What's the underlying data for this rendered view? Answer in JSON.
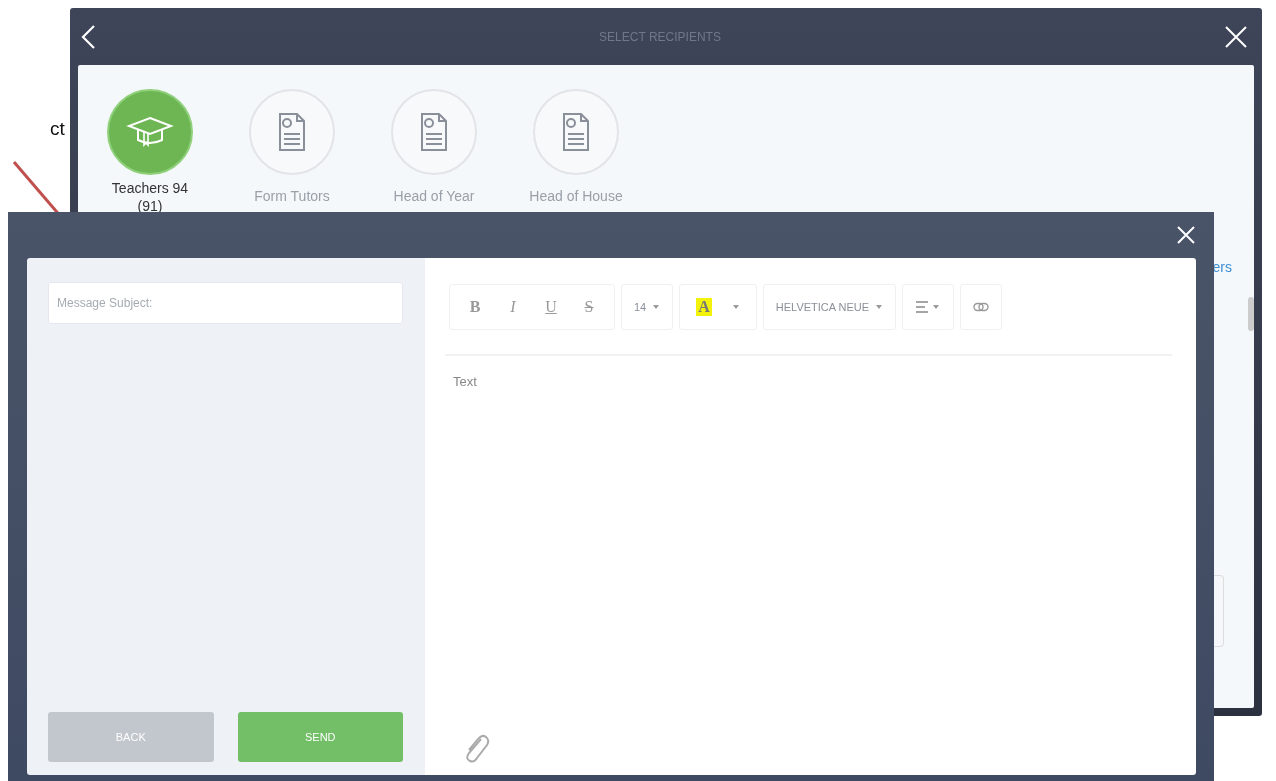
{
  "annotation": {
    "text": "ct"
  },
  "recipients_dialog": {
    "title": "SELECT RECIPIENTS",
    "groups": [
      {
        "label": "Teachers 94 (91)",
        "kind": "cap",
        "selected": true
      },
      {
        "label": "Form Tutors",
        "kind": "document",
        "selected": false
      },
      {
        "label": "Head of Year",
        "kind": "document",
        "selected": false
      },
      {
        "label": "Head of House",
        "kind": "document",
        "selected": false
      }
    ],
    "link_fragment": "ers"
  },
  "compose_dialog": {
    "subject_placeholder": "Message Subject:",
    "toolbar": [
      {
        "kind": "format",
        "items": [
          {
            "label": "B",
            "kind": "bold"
          },
          {
            "label": "I",
            "kind": "italic"
          },
          {
            "label": "U",
            "kind": "underline"
          },
          {
            "label": "S",
            "kind": "strike"
          }
        ]
      },
      {
        "kind": "size",
        "label": "14"
      },
      {
        "kind": "highlight",
        "label": "A"
      },
      {
        "kind": "font",
        "label": "HELVETICA NEUE"
      },
      {
        "kind": "align"
      },
      {
        "kind": "link"
      }
    ],
    "body_placeholder": "Text",
    "buttons": [
      {
        "label": "BACK",
        "kind": "secondary"
      },
      {
        "label": "SEND",
        "kind": "primary"
      }
    ]
  }
}
